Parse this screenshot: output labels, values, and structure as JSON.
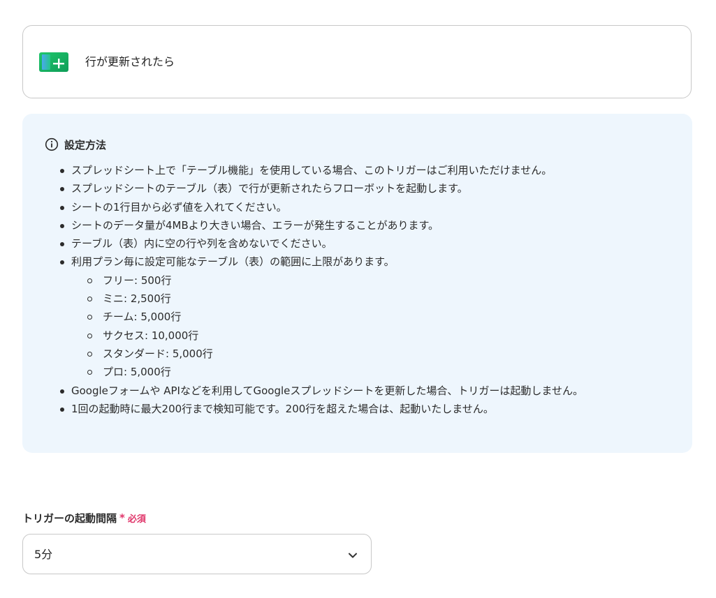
{
  "trigger": {
    "icon": "google-sheets-icon",
    "label": "行が更新されたら"
  },
  "info": {
    "icon": "info-circle-icon",
    "title": "設定方法",
    "items": [
      "スプレッドシート上で「テーブル機能」を使用している場合、このトリガーはご利用いただけません。",
      "スプレッドシートのテーブル（表）で行が更新されたらフローボットを起動します。",
      "シートの1行目から必ず値を入れてください。",
      "シートのデータ量が4MBより大きい場合、エラーが発生することがあります。",
      "テーブル（表）内に空の行や列を含めないでください。",
      "利用プラン毎に設定可能なテーブル（表）の範囲に上限があります。",
      "Googleフォームや APIなどを利用してGoogleスプレッドシートを更新した場合、トリガーは起動しません。",
      "1回の起動時に最大200行まで検知可能です。200行を超えた場合は、起動いたしません。"
    ],
    "plan_limits": [
      "フリー: 500行",
      "ミニ: 2,500行",
      "チーム: 5,000行",
      "サクセス: 10,000行",
      "スタンダード: 5,000行",
      "プロ: 5,000行"
    ]
  },
  "interval_field": {
    "label": "トリガーの起動間隔",
    "required_mark": "*",
    "required_text": "必須",
    "selected_value": "5分",
    "chevron_icon": "chevron-down-icon"
  },
  "colors": {
    "required": "#e0356a",
    "panel_bg": "#eef6fd",
    "border": "#c8c8c8"
  }
}
